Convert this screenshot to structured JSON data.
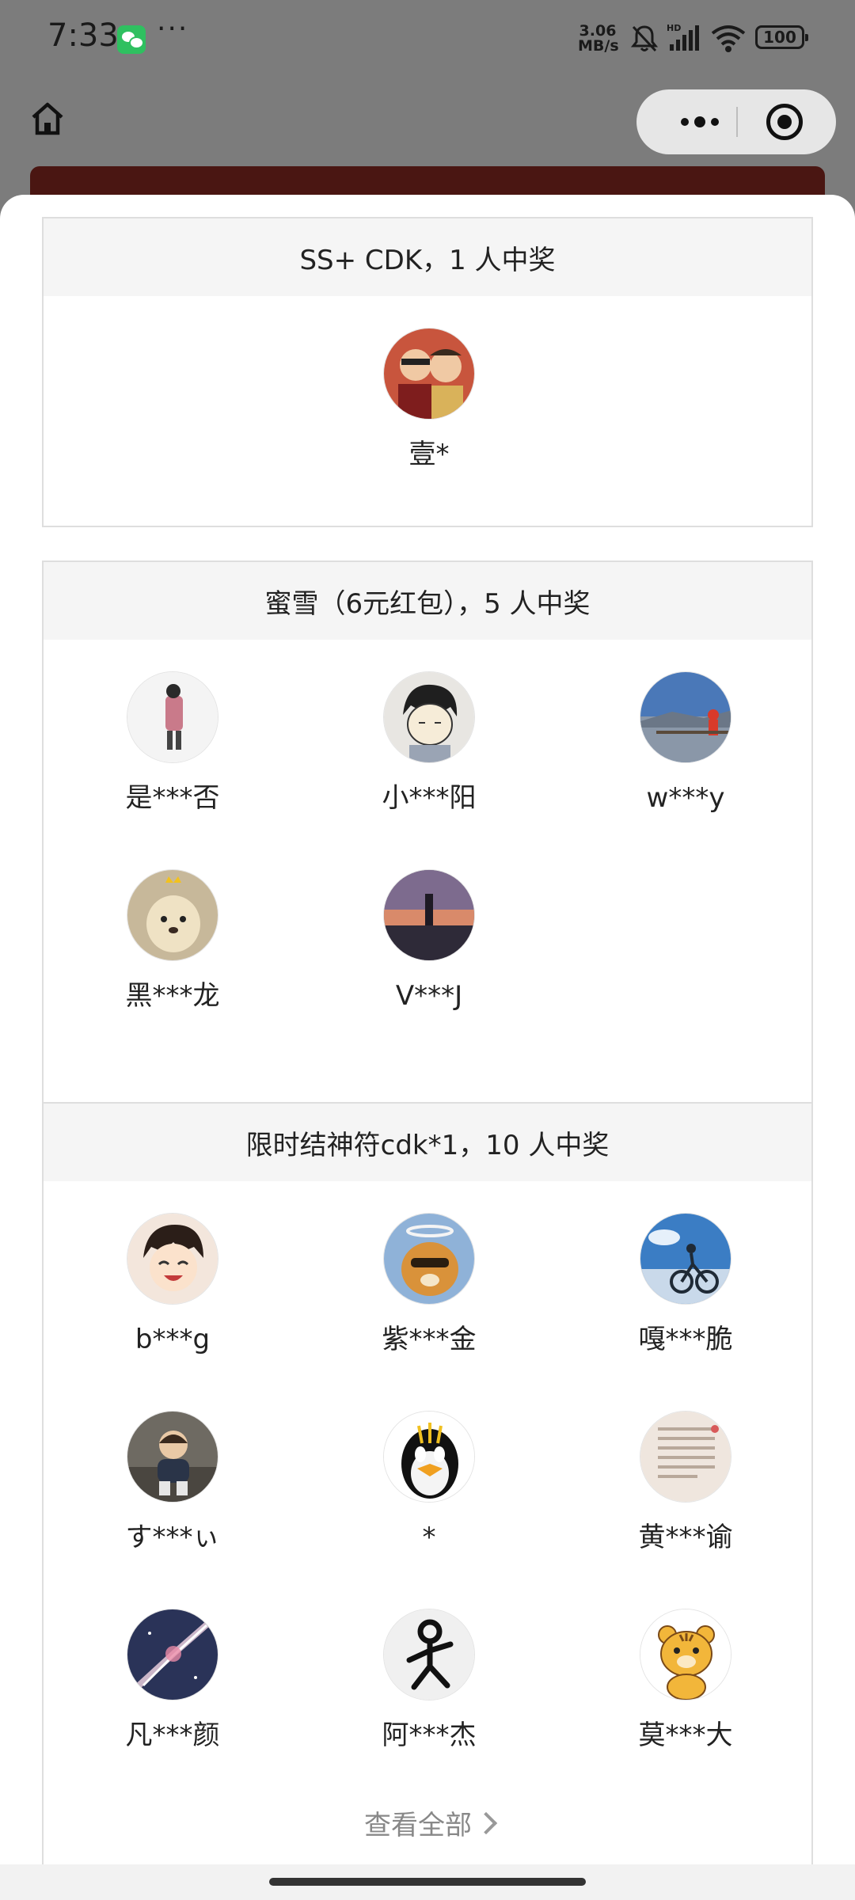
{
  "status_bar": {
    "time": "7:33",
    "more": "···",
    "speed_value": "3.06",
    "speed_unit": "MB/s",
    "network": "HD",
    "battery": "100"
  },
  "nav": {
    "home_icon": "home-icon",
    "capsule_more_icon": "more-dots-icon",
    "capsule_close_icon": "target-close-icon"
  },
  "prizes": [
    {
      "title": "SS+ CDK，1 人中奖",
      "winners": [
        {
          "name": "壹*",
          "avatar_color": "#c8553d"
        }
      ]
    },
    {
      "title": "蜜雪（6元红包），5 人中奖",
      "winners": [
        {
          "name": "是***否",
          "avatar_color": "#f4f4f4"
        },
        {
          "name": "小***阳",
          "avatar_color": "#e8e6e2"
        },
        {
          "name": "w***y",
          "avatar_color": "#4a78b8"
        },
        {
          "name": "黑***龙",
          "avatar_color": "#c7b89a"
        },
        {
          "name": "V***J",
          "avatar_color": "#5b4a66"
        }
      ]
    },
    {
      "title": "限时结神符cdk*1，10 人中奖",
      "winners": [
        {
          "name": "b***g",
          "avatar_color": "#f3e6dc"
        },
        {
          "name": "紫***金",
          "avatar_color": "#8fb2d8"
        },
        {
          "name": "嘎***脆",
          "avatar_color": "#3b7dc4"
        },
        {
          "name": "す***ぃ",
          "avatar_color": "#6e6a62"
        },
        {
          "name": "*",
          "avatar_color": "#ffffff"
        },
        {
          "name": "黄***谕",
          "avatar_color": "#efe6de"
        },
        {
          "name": "凡***颜",
          "avatar_color": "#2a3358"
        },
        {
          "name": "阿***杰",
          "avatar_color": "#f0f0f0"
        },
        {
          "name": "莫***大",
          "avatar_color": "#ffffff"
        }
      ],
      "view_all": "查看全部"
    }
  ]
}
